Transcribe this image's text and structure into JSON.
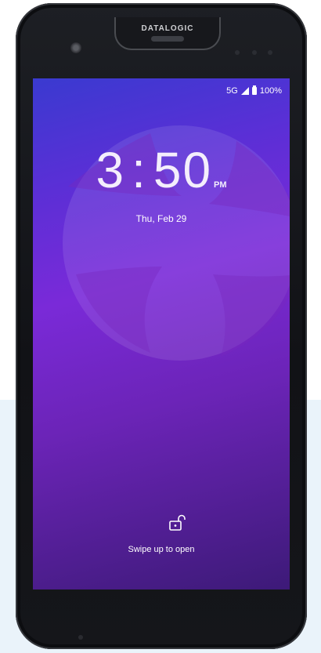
{
  "device": {
    "brand": "DATALOGIC"
  },
  "status_bar": {
    "network": "5G",
    "battery": "100%"
  },
  "lock_screen": {
    "hours": "3",
    "minutes": "50",
    "colon": ":",
    "ampm": "PM",
    "date": "Thu, Feb 29",
    "swipe_hint": "Swipe up to open"
  },
  "colors": {
    "wallpaper_top": "#3a3ad0",
    "wallpaper_mid": "#7a2ad8",
    "wallpaper_bottom": "#3d1a78",
    "device_body": "#15161a"
  },
  "icons": [
    "signal-icon",
    "battery-icon",
    "lock-open-icon"
  ]
}
